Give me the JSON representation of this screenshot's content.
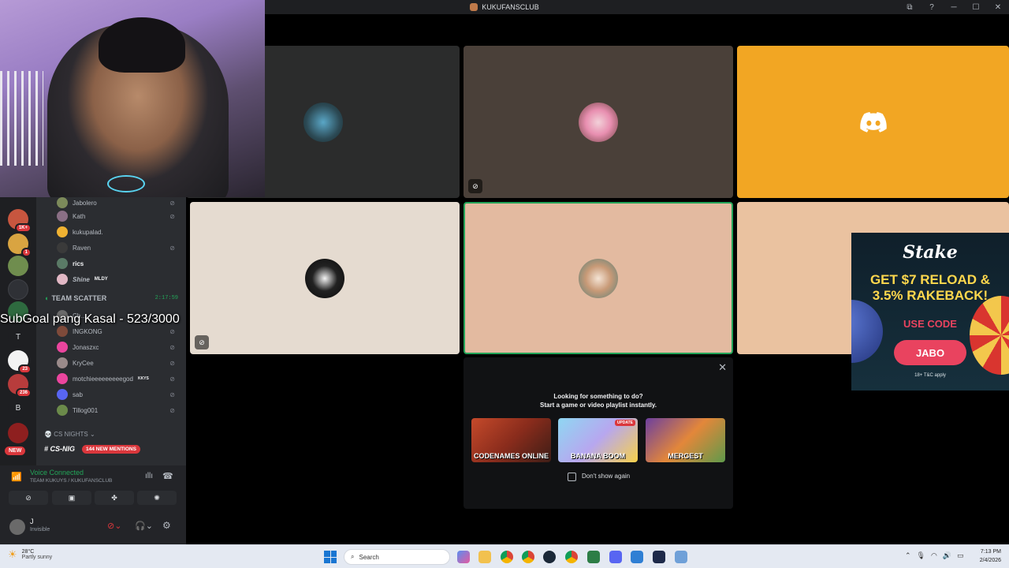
{
  "window": {
    "title": "KUKUFANSCLUB",
    "controls": [
      "⧉",
      "?",
      "─",
      "☐",
      "✕"
    ]
  },
  "overlay": {
    "subgoal": "SubGoal pang Kasal - 523/3000"
  },
  "servers": {
    "badges": [
      "1K+",
      "1",
      "23",
      "236"
    ],
    "letters": [
      "T",
      "B"
    ],
    "new_label": "NEW"
  },
  "channel": {
    "members_top": [
      {
        "name": "Jabolero",
        "muted": true
      },
      {
        "name": "Kath",
        "muted": true
      },
      {
        "name": "kukupalad.",
        "muted": false
      },
      {
        "name": "Raven",
        "muted": true
      },
      {
        "name": "rics",
        "muted": false
      },
      {
        "name": "Shine",
        "tag": "MLDY",
        "muted": false
      }
    ],
    "team_name": "TEAM SCATTER",
    "team_time": "2:17:59",
    "members_bottom": [
      {
        "name": "Ch...",
        "muted": false
      },
      {
        "name": "INGKONG",
        "muted": true
      },
      {
        "name": "Jonaszxc",
        "muted": true
      },
      {
        "name": "KryCee",
        "muted": true
      },
      {
        "name": "motchieeeeeeeeegod",
        "tag": "KKYS",
        "muted": true
      },
      {
        "name": "sab",
        "muted": true
      },
      {
        "name": "Tillog001",
        "muted": true
      }
    ],
    "category": "CS NIGHTS",
    "channel_name": "CS-NIG",
    "mentions": "144 NEW MENTIONS"
  },
  "voice": {
    "status": "Voice Connected",
    "location": "TEAM KUKUYS / KUKUFANSCLUB",
    "buttons": [
      "camera-off",
      "screen-share",
      "activities",
      "soundboard"
    ]
  },
  "user": {
    "name": "J",
    "status": "Invisible"
  },
  "tiles": [
    {
      "bg": "#2b2c2c",
      "muted": false
    },
    {
      "bg": "#4a4039",
      "muted": true
    },
    {
      "bg": "#f2a623",
      "muted": false,
      "logo": true
    },
    {
      "bg": "#e5dbd0",
      "muted": true
    },
    {
      "bg": "#e3baa0",
      "muted": false,
      "speaking": true
    },
    {
      "bg": "#eac2a0",
      "muted": false
    }
  ],
  "activity": {
    "line1": "Looking for something to do?",
    "line2": "Start a game or video playlist instantly.",
    "games": [
      {
        "name": "CODENAMES ONLINE"
      },
      {
        "name": "BANANA BOOM",
        "badge": "UPDATE"
      },
      {
        "name": "MERGEST"
      }
    ],
    "dont_show": "Don't show again"
  },
  "ad": {
    "brand": "Stake",
    "line1": "GET $7 RELOAD &",
    "line2": "3.5% RAKEBACK!",
    "use_code": "USE CODE",
    "code": "JABO",
    "terms": "18+ T&C apply"
  },
  "taskbar": {
    "weather_temp": "28°C",
    "weather_cond": "Partly sunny",
    "search": "Search",
    "time": "7:13 PM",
    "date": "2/4/2026"
  },
  "colors": {
    "discord_bg": "#2b2d31",
    "accent_green": "#23a559",
    "alert_red": "#da373c"
  }
}
